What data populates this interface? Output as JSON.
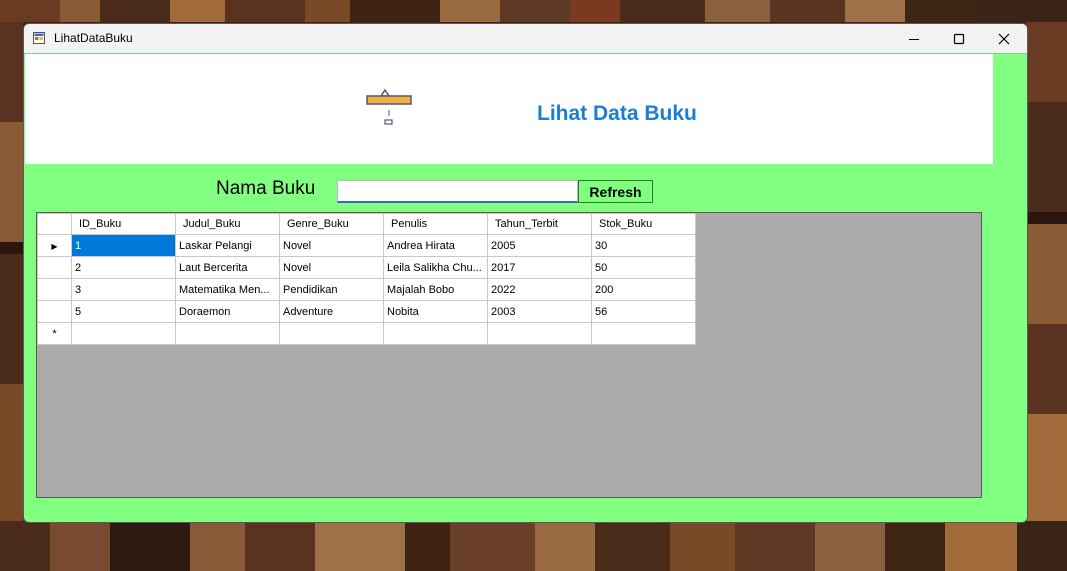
{
  "window": {
    "title": "LihatDataBuku",
    "minimize_icon": "minimize-icon",
    "maximize_icon": "maximize-icon",
    "close_icon": "close-icon"
  },
  "header": {
    "title": "Lihat Data Buku",
    "logo_icon": "library-logo-icon"
  },
  "search": {
    "label": "Nama Buku",
    "value": "",
    "placeholder": "",
    "button_label": "Refresh"
  },
  "grid": {
    "columns": [
      "ID_Buku",
      "Judul_Buku",
      "Genre_Buku",
      "Penulis",
      "Tahun_Terbit",
      "Stok_Buku"
    ],
    "rows": [
      {
        "marker": "▶",
        "cells": [
          "1",
          "Laskar Pelangi",
          "Novel",
          "Andrea Hirata",
          "2005",
          "30"
        ]
      },
      {
        "marker": "",
        "cells": [
          "2",
          "Laut Bercerita",
          "Novel",
          "Leila Salikha Chu...",
          "2017",
          "50"
        ]
      },
      {
        "marker": "",
        "cells": [
          "3",
          "Matematika Men...",
          "Pendidikan",
          "Majalah Bobo",
          "2022",
          "200"
        ]
      },
      {
        "marker": "",
        "cells": [
          "5",
          "Doraemon",
          "Adventure",
          "Nobita",
          "2003",
          "56"
        ]
      }
    ],
    "new_row_marker": "*",
    "selected_cell": "ID_Buku of row 1"
  },
  "colors": {
    "form_background": "#80ff80",
    "title_accent": "#1a7fd4",
    "selection": "#0078d7",
    "grid_background": "#ababab"
  }
}
